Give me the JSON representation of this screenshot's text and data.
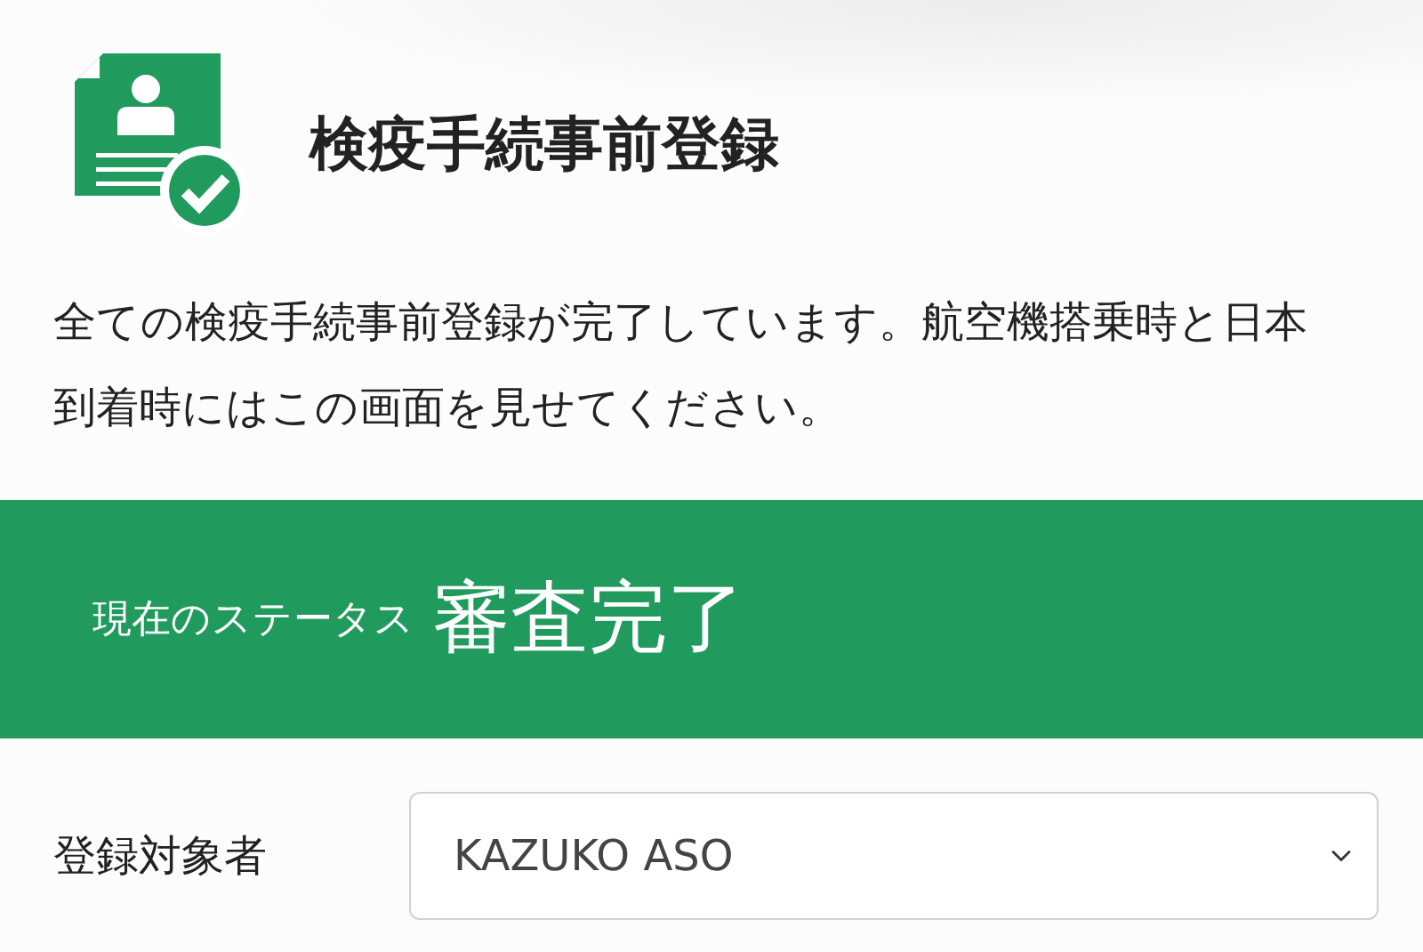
{
  "header": {
    "title": "検疫手続事前登録"
  },
  "message": "全ての検疫手続事前登録が完了しています。航空機搭乗時と日本到着時にはこの画面を見せてください。",
  "status": {
    "label": "現在のステータス",
    "value": "審査完了"
  },
  "person_field": {
    "label": "登録対象者",
    "value": "KAZUKO ASO"
  }
}
